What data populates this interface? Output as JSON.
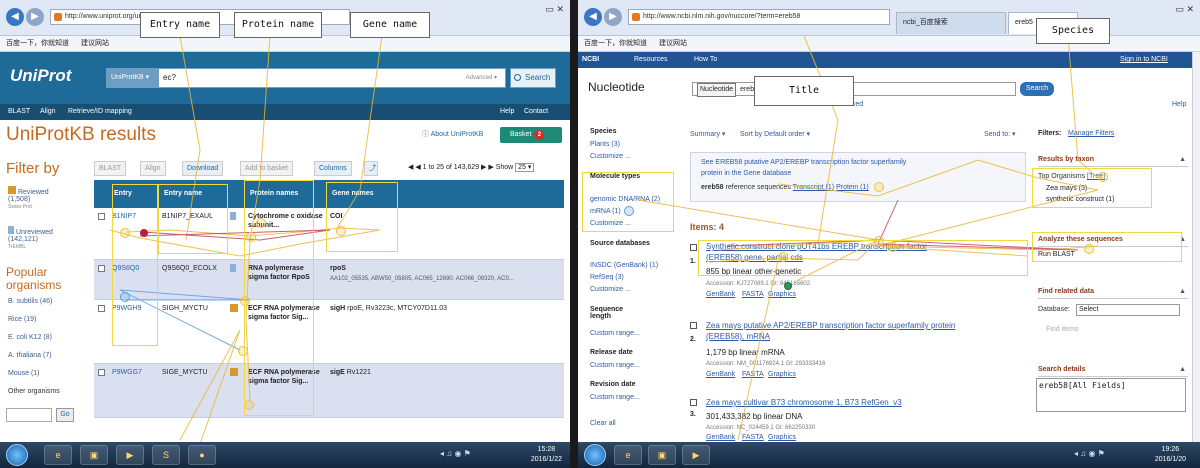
{
  "left": {
    "address": "http://www.uniprot.org/uniprot/",
    "favorites": [
      "百度一下，你就知道",
      "建议网站"
    ],
    "header": {
      "logo": "UniProt",
      "db_select": "UniProtKB ▾",
      "query": "ec?",
      "advanced": "Advanced ▾",
      "search_label": "Search"
    },
    "subnav": {
      "blast": "BLAST",
      "align": "Align",
      "retrieve": "Retrieve/ID mapping",
      "help": "Help",
      "contact": "Contact"
    },
    "title": "UniProtKB results",
    "about": "About UniProtKB",
    "basket": {
      "label": "Basket",
      "count": "2"
    },
    "filter": {
      "heading": "Filter by",
      "reviewed": "Reviewed",
      "reviewed_count": "(1,508)",
      "reviewed_sub": "Swiss-Prot",
      "unreviewed": "Unreviewed",
      "unreviewed_count": "(142,121)",
      "unreviewed_sub": "TrEMBL",
      "popular_heading": "Popular organisms",
      "organisms": [
        "B. subtilis (46)",
        "Rice (19)",
        "E. coli K12 (8)",
        "A. thaliana (7)",
        "Mouse (1)"
      ],
      "other": "Other organisms",
      "go": "Go"
    },
    "toolbar": {
      "blast": "BLAST",
      "align": "Align",
      "download": "Download",
      "add_basket": "Add to basket",
      "columns": "Columns",
      "pager": "1 to 25 of 143,629",
      "show": "Show",
      "show_value": "25 ▾"
    },
    "table": {
      "headers": [
        "Entry",
        "Entry name",
        "Protein names",
        "Gene names"
      ],
      "rows": [
        {
          "entry": "B1NIP7",
          "entry_name": "B1NIP7_EXAUL",
          "protein": "Cytochrome c oxidase subunit",
          "protein_more": "...",
          "gene": "COI",
          "gene_more": ""
        },
        {
          "entry": "Q9S6Q0",
          "entry_name": "Q9S6Q0_ECOLX",
          "protein": "RNA polymerase sigma factor",
          "protein_more": "RpoS",
          "gene": "rpoS",
          "gene_more": "AA102_05535, ABW50_05805, AC065_12690, AC066_09320, AC0..."
        },
        {
          "entry": "P9WGH9",
          "entry_name": "SIGH_MYCTU",
          "protein": "ECF RNA polymerase sigma factor",
          "protein_more": "Sig...",
          "gene": "sigH",
          "gene_more": "rpoE, Rv3223c, MTCY07D11.03"
        },
        {
          "entry": "P9WGG7",
          "entry_name": "SIGE_MYCTU",
          "protein": "ECF RNA polymerase sigma factor",
          "protein_more": "Sig...",
          "gene": "sigE",
          "gene_more": "Rv1221"
        }
      ]
    },
    "callouts": {
      "entry": "Entry name",
      "protein": "Protein name",
      "gene": "Gene name"
    },
    "clock": {
      "time": "15:28",
      "date": "2016/1/22"
    }
  },
  "right": {
    "address": "http://www.ncbi.nlm.nih.gov/nuccore/?term=ereb58",
    "tabs": [
      "ncbi_百度搜索",
      "ereb5"
    ],
    "favorites": [
      "百度一下，你就知道",
      "建议网站"
    ],
    "header": {
      "logo": "NCBI",
      "resources": "Resources",
      "howto": "How To",
      "signin": "Sign in to NCBI"
    },
    "db": "Nucleotide",
    "db_select": "Nucleotide",
    "query": "ereb58",
    "search_label": "Search",
    "links": {
      "alert": "Alert",
      "advanced": "Advanced",
      "help": "Help"
    },
    "sidebar": {
      "species_h": "Species",
      "species_items": [
        "Plants (3)",
        "Customize ..."
      ],
      "moltype_h": "Molecule types",
      "moltype_items": [
        "genomic DNA/RNA (2)",
        "mRNA (1)",
        "Customize ..."
      ],
      "source_h": "Source databases",
      "source_items": [
        "INSDC (GenBank) (1)",
        "RefSeq (3)",
        "Customize ..."
      ],
      "seqlen_h": "Sequence length",
      "seqlen_item": "Custom range...",
      "release_h": "Release date",
      "release_item": "Custom range...",
      "revision_h": "Revision date",
      "revision_item": "Custom range...",
      "clear": "Clear all"
    },
    "summary_bar": {
      "summary": "Summary ▾",
      "sort": "Sort by Default order ▾",
      "send": "Send to: ▾",
      "filters": "Filters:",
      "manage": "Manage Filters"
    },
    "gene_box": {
      "line1": "See EREB58 putative AP2/EREBP transcription factor superfamily",
      "line2": "protein in the Gene database",
      "line3_a": "ereb58",
      "line3_b": "reference sequences",
      "transcript": "Transcript (1)",
      "protein": "Protein (1)"
    },
    "items_label": "Items: 4",
    "results": [
      {
        "num": "1.",
        "title1": "Synthetic construct clone pUT41bs EREBP transcription factor",
        "title2": "(EREB58) gene, partial cds",
        "sub": "855 bp linear other-genetic",
        "meta": "Accession: KJ727089.1   GI: 645165602",
        "links": [
          "GenBank",
          "FASTA",
          "Graphics"
        ]
      },
      {
        "num": "2.",
        "title1": "Zea mays putative AP2/EREBP transcription factor superfamily protein",
        "title2": "(EREB58), mRNA",
        "sub": "1,179 bp linear mRNA",
        "meta": "Accession: NM_001176924.1   GI: 293333416",
        "links": [
          "GenBank",
          "FASTA",
          "Graphics"
        ]
      },
      {
        "num": "3.",
        "title1": "Zea mays cultivar B73 chromosome 1, B73 RefGen_v3",
        "title2": "",
        "sub": "301,433,382 bp linear DNA",
        "meta": "Accession: NC_024459.1   GI: 662250330",
        "links": [
          "GenBank",
          "FASTA",
          "Graphics"
        ]
      }
    ],
    "right_panel": {
      "taxon_h": "Results by taxon",
      "top_organisms": "Top Organisms",
      "tree": "[Tree]",
      "taxa": [
        "Zea mays (3)",
        "synthetic construct (1)"
      ],
      "analyze_h": "Analyze these sequences",
      "run_blast": "Run BLAST",
      "related_h": "Find related data",
      "database": "Database:",
      "select": "Select",
      "find_items": "Find items",
      "search_h": "Search details",
      "search_details": "ereb58[All Fields]"
    },
    "callouts": {
      "title": "Title",
      "species": "Species"
    },
    "clock": {
      "time": "19:26",
      "date": "2016/1/20"
    }
  }
}
